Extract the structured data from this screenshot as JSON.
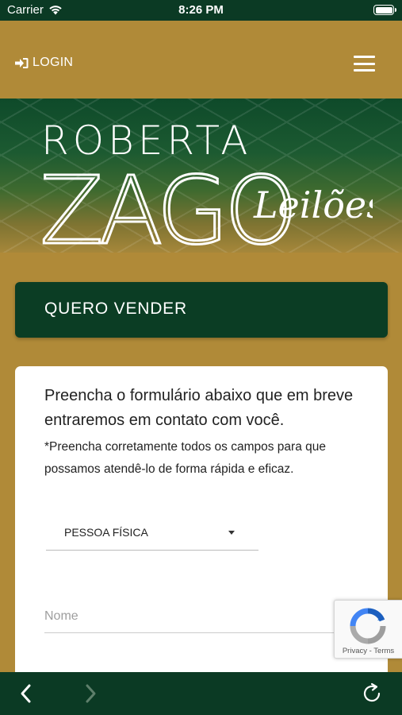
{
  "status_bar": {
    "carrier": "Carrier",
    "time": "8:26 PM"
  },
  "header": {
    "login_label": "LOGIN"
  },
  "banner": {
    "logo_line1": "ROBERTA",
    "logo_line2": "ZAGO",
    "logo_script": "Leilões"
  },
  "section": {
    "title": "QUERO VENDER"
  },
  "form": {
    "intro": "Preencha o formulário abaixo que em breve entraremos em contato com você.",
    "note": "*Preencha corretamente todos os campos para que possamos atendê-lo de forma rápida e eficaz.",
    "person_type": "PESSOA FÍSICA",
    "name_placeholder": "Nome"
  },
  "recaptcha": {
    "privacy": "Privacy",
    "separator": " - ",
    "terms": "Terms"
  },
  "colors": {
    "gold": "#b08a38",
    "dark_green": "#0b3d24",
    "card": "#ffffff"
  },
  "icons": {
    "login": "sign-in-icon",
    "menu": "hamburger-menu-icon",
    "back": "chevron-left-icon",
    "forward": "chevron-right-icon",
    "reload": "reload-icon"
  }
}
